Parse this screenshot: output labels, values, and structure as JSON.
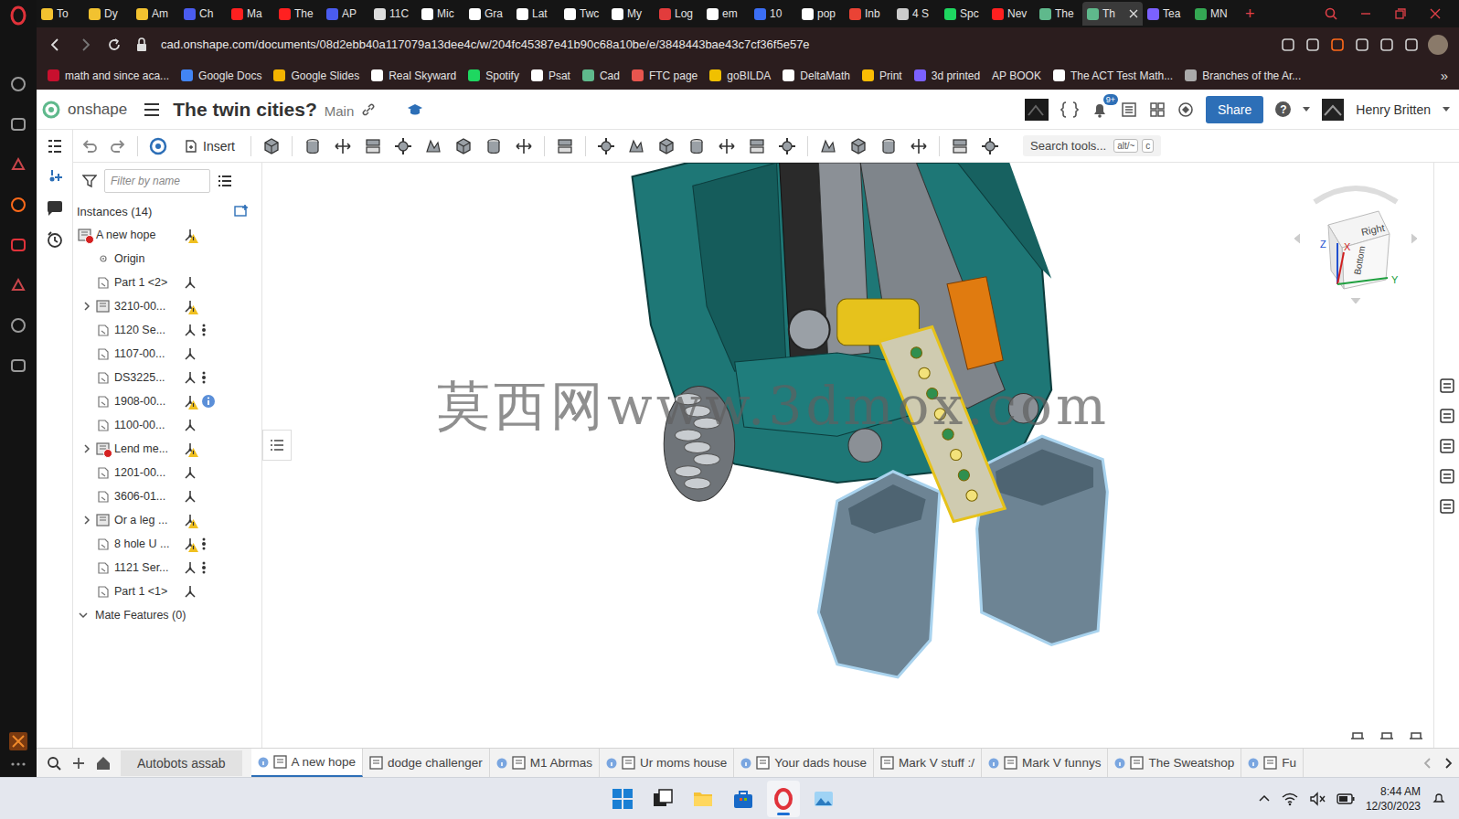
{
  "browser": {
    "tabs": [
      {
        "label": "To",
        "selected": false,
        "color": "#f2c230"
      },
      {
        "label": "Dy",
        "selected": false,
        "color": "#f2c230"
      },
      {
        "label": "Am",
        "selected": false,
        "color": "#f2c230"
      },
      {
        "label": "Ch",
        "selected": false,
        "color": "#4a5cf0"
      },
      {
        "label": "Ma",
        "selected": false,
        "color": "#ff2020"
      },
      {
        "label": "The",
        "selected": false,
        "color": "#ff2020"
      },
      {
        "label": "AP",
        "selected": false,
        "color": "#4a5cf0"
      },
      {
        "label": "11C",
        "selected": false,
        "color": "#dddddd"
      },
      {
        "label": "Mic",
        "selected": false,
        "color": "#ffffff"
      },
      {
        "label": "Gra",
        "selected": false,
        "color": "#ffffff"
      },
      {
        "label": "Lat",
        "selected": false,
        "color": "#ffffff"
      },
      {
        "label": "Twc",
        "selected": false,
        "color": "#ffffff"
      },
      {
        "label": "My",
        "selected": false,
        "color": "#ffffff"
      },
      {
        "label": "Log",
        "selected": false,
        "color": "#e23c3c"
      },
      {
        "label": "em",
        "selected": false,
        "color": "#ffffff"
      },
      {
        "label": "10",
        "selected": false,
        "color": "#3b6ef5"
      },
      {
        "label": "pop",
        "selected": false,
        "color": "#ffffff"
      },
      {
        "label": "Inb",
        "selected": false,
        "color": "#ea4335"
      },
      {
        "label": "4 S",
        "selected": false,
        "color": "#cccccc"
      },
      {
        "label": "Spc",
        "selected": false,
        "color": "#1ed760"
      },
      {
        "label": "Nev",
        "selected": false,
        "color": "#ff2020"
      },
      {
        "label": "The",
        "selected": false,
        "color": "#5fb98c"
      },
      {
        "label": "Th",
        "selected": true,
        "color": "#5fb98c"
      },
      {
        "label": "Tea",
        "selected": false,
        "color": "#7b61ff"
      },
      {
        "label": "MN",
        "selected": false,
        "color": "#34a853"
      }
    ],
    "new_tab": "+",
    "url": "cad.onshape.com/documents/08d2ebb40a117079a13dee4c/w/204fc45387e41b90c68a10be/e/3848443bae43c7cf36f5e57e",
    "bookmarks": [
      {
        "label": "math and since aca...",
        "color": "#c8102e",
        "has_icon": true
      },
      {
        "label": "Google Docs",
        "color": "#4285f4",
        "has_icon": true
      },
      {
        "label": "Google Slides",
        "color": "#f4b400",
        "has_icon": true
      },
      {
        "label": "Real Skyward",
        "color": "#ffffff",
        "has_icon": true
      },
      {
        "label": "Spotify",
        "color": "#1ed760",
        "has_icon": true
      },
      {
        "label": "Psat",
        "color": "#ffffff",
        "has_icon": true
      },
      {
        "label": "Cad",
        "color": "#5fb98c",
        "has_icon": true
      },
      {
        "label": "FTC page",
        "color": "#e8554e",
        "has_icon": true
      },
      {
        "label": "goBILDA",
        "color": "#f0c000",
        "has_icon": true
      },
      {
        "label": "DeltaMath",
        "color": "#ffffff",
        "has_icon": true
      },
      {
        "label": "Print",
        "color": "#fbbc04",
        "has_icon": true
      },
      {
        "label": "3d printed",
        "color": "#7b61ff",
        "has_icon": true
      },
      {
        "label": "AP BOOK",
        "color": "#ffffff",
        "has_icon": false
      },
      {
        "label": "The ACT Test Math...",
        "color": "#ffffff",
        "has_icon": true
      },
      {
        "label": "Branches of the Ar...",
        "color": "#aaaaaa",
        "has_icon": true
      }
    ],
    "bookmarks_more": "»"
  },
  "onshape": {
    "logo": "onshape",
    "title": "The twin cities?",
    "branch": "Main",
    "notifications": "9+",
    "share": "Share",
    "help": "?",
    "user": "Henry Britten",
    "insert": "Insert",
    "search_tools": "Search tools...",
    "search_keys": [
      "alt/~",
      "c"
    ],
    "filter_placeholder": "Filter by name",
    "instances_title": "Instances (14)",
    "instances": [
      {
        "label": "A new hope",
        "kind": "assembly",
        "level": 0,
        "expandable": false,
        "expanded": false,
        "error": true,
        "status": "warning",
        "connector": false,
        "info": false
      },
      {
        "label": "Origin",
        "kind": "origin",
        "level": 1,
        "expandable": false,
        "expanded": false,
        "error": false,
        "status": "none",
        "connector": false,
        "info": false
      },
      {
        "label": "Part 1 <2>",
        "kind": "part",
        "level": 1,
        "expandable": false,
        "expanded": false,
        "error": false,
        "status": "mated",
        "connector": false,
        "info": false
      },
      {
        "label": "3210-00...",
        "kind": "assembly",
        "level": 1,
        "expandable": true,
        "expanded": false,
        "error": false,
        "status": "warning",
        "connector": false,
        "info": false
      },
      {
        "label": "1120 Se...",
        "kind": "part",
        "level": 1,
        "expandable": false,
        "expanded": false,
        "error": false,
        "status": "mated",
        "connector": true,
        "info": false
      },
      {
        "label": "1107-00...",
        "kind": "part",
        "level": 1,
        "expandable": false,
        "expanded": false,
        "error": false,
        "status": "mated",
        "connector": false,
        "info": false
      },
      {
        "label": "DS3225...",
        "kind": "part",
        "level": 1,
        "expandable": false,
        "expanded": false,
        "error": false,
        "status": "mated",
        "connector": true,
        "info": false
      },
      {
        "label": "1908-00...",
        "kind": "part",
        "level": 1,
        "expandable": false,
        "expanded": false,
        "error": false,
        "status": "warning",
        "connector": false,
        "info": true
      },
      {
        "label": "1100-00...",
        "kind": "part",
        "level": 1,
        "expandable": false,
        "expanded": false,
        "error": false,
        "status": "mated",
        "connector": false,
        "info": false
      },
      {
        "label": "Lend me...",
        "kind": "assembly",
        "level": 1,
        "expandable": true,
        "expanded": false,
        "error": true,
        "status": "warning",
        "connector": false,
        "info": false
      },
      {
        "label": "1201-00...",
        "kind": "part",
        "level": 1,
        "expandable": false,
        "expanded": false,
        "error": false,
        "status": "mated",
        "connector": false,
        "info": false
      },
      {
        "label": "3606-01...",
        "kind": "part",
        "level": 1,
        "expandable": false,
        "expanded": false,
        "error": false,
        "status": "mated",
        "connector": false,
        "info": false
      },
      {
        "label": "Or a leg ...",
        "kind": "assembly",
        "level": 1,
        "expandable": true,
        "expanded": false,
        "error": false,
        "status": "warning",
        "connector": false,
        "info": false
      },
      {
        "label": "8 hole U ...",
        "kind": "part",
        "level": 1,
        "expandable": false,
        "expanded": false,
        "error": false,
        "status": "warning",
        "connector": true,
        "info": false
      },
      {
        "label": "1121 Ser...",
        "kind": "part",
        "level": 1,
        "expandable": false,
        "expanded": false,
        "error": false,
        "status": "mated",
        "connector": true,
        "info": false
      },
      {
        "label": "Part 1 <1>",
        "kind": "part",
        "level": 1,
        "expandable": false,
        "expanded": false,
        "error": false,
        "status": "mated",
        "connector": false,
        "info": false
      }
    ],
    "mate_features": {
      "label": "Mate Features (0)",
      "expanded": true
    },
    "watermark": "莫西网www.3dmox.com",
    "view_cube": {
      "faces": [
        "Right",
        "Bottom"
      ],
      "axes": [
        {
          "label": "Z",
          "color": "#2050d0"
        },
        {
          "label": "X",
          "color": "#d02020"
        },
        {
          "label": "Y",
          "color": "#20a040"
        }
      ]
    },
    "document_tabs": {
      "folder": "Autobots assab",
      "tabs": [
        {
          "label": "A new hope",
          "selected": true,
          "linked": true
        },
        {
          "label": "dodge challenger",
          "selected": false,
          "linked": false
        },
        {
          "label": "M1 Abrmas",
          "selected": false,
          "linked": true
        },
        {
          "label": "Ur moms house",
          "selected": false,
          "linked": true
        },
        {
          "label": "Your dads house",
          "selected": false,
          "linked": true
        },
        {
          "label": "Mark V stuff :/",
          "selected": false,
          "linked": false
        },
        {
          "label": "Mark V funnys",
          "selected": false,
          "linked": true
        },
        {
          "label": "The Sweatshop",
          "selected": false,
          "linked": true
        },
        {
          "label": "Fu",
          "selected": false,
          "linked": true
        }
      ]
    }
  },
  "taskbar": {
    "apps": [
      {
        "kind": "start",
        "selected": false
      },
      {
        "kind": "taskview",
        "selected": false
      },
      {
        "kind": "explorer",
        "selected": false
      },
      {
        "kind": "store",
        "selected": false
      },
      {
        "kind": "opera",
        "selected": true
      },
      {
        "kind": "photos",
        "selected": false
      }
    ],
    "time": "8:44 AM",
    "date": "12/30/2023"
  }
}
